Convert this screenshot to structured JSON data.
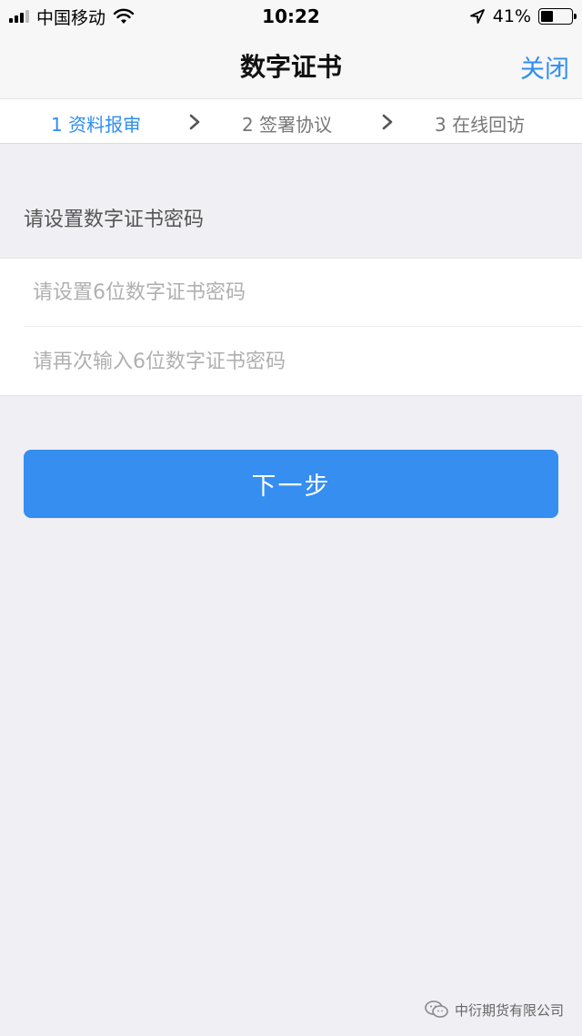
{
  "status_bar": {
    "carrier": "中国移动",
    "time": "10:22",
    "battery_text": "41%",
    "battery_level": 0.41
  },
  "nav": {
    "title": "数字证书",
    "close_label": "关闭"
  },
  "steps": [
    {
      "label": "1 资料报审",
      "active": true
    },
    {
      "label": "2 签署协议",
      "active": false
    },
    {
      "label": "3 在线回访",
      "active": false
    }
  ],
  "form": {
    "section_label": "请设置数字证书密码",
    "password_placeholder": "请设置6位数字证书密码",
    "confirm_placeholder": "请再次输入6位数字证书密码",
    "password_value": "",
    "confirm_value": ""
  },
  "next_button_label": "下一步",
  "watermark": "中衍期货有限公司",
  "colors": {
    "accent": "#2f8ef0",
    "button": "#358ef0",
    "background": "#efeff4"
  },
  "icons": [
    "signal-icon",
    "wifi-icon",
    "location-arrow-icon",
    "battery-icon",
    "chevron-right-icon",
    "wechat-icon"
  ]
}
